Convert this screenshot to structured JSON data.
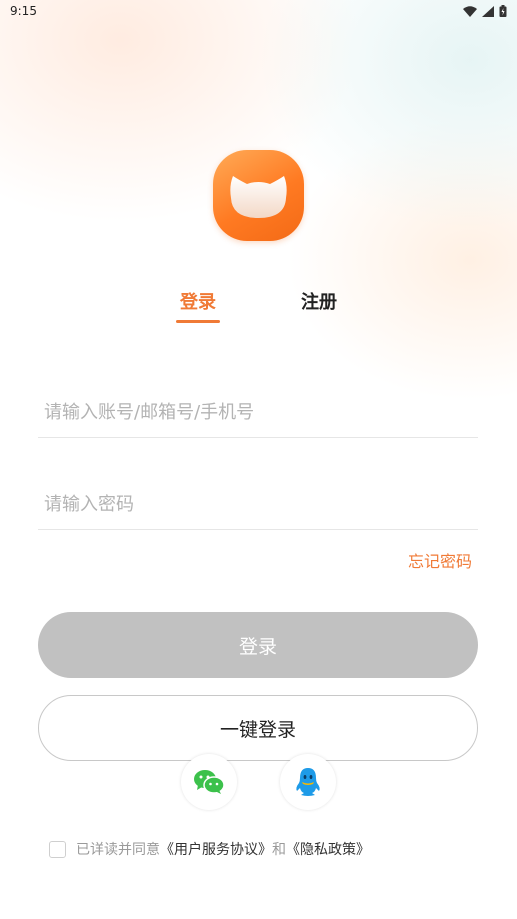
{
  "status_bar": {
    "time": "9:15"
  },
  "tabs": {
    "login": "登录",
    "register": "注册"
  },
  "form": {
    "account_placeholder": "请输入账号/邮箱号/手机号",
    "account_value": "",
    "password_placeholder": "请输入密码",
    "password_value": "",
    "forgot_password": "忘记密码"
  },
  "buttons": {
    "login": "登录",
    "one_key_login": "一键登录"
  },
  "social": {
    "wechat_icon": "wechat-icon",
    "qq_icon": "qq-icon"
  },
  "agreement": {
    "prefix": "已详读并同意",
    "user_agreement": "《用户服务协议》",
    "and": "和",
    "privacy_policy": "《隐私政策》"
  },
  "colors": {
    "accent": "#f07a36",
    "disabled_button": "#c1c1c1",
    "logo": "#ff7a22"
  }
}
